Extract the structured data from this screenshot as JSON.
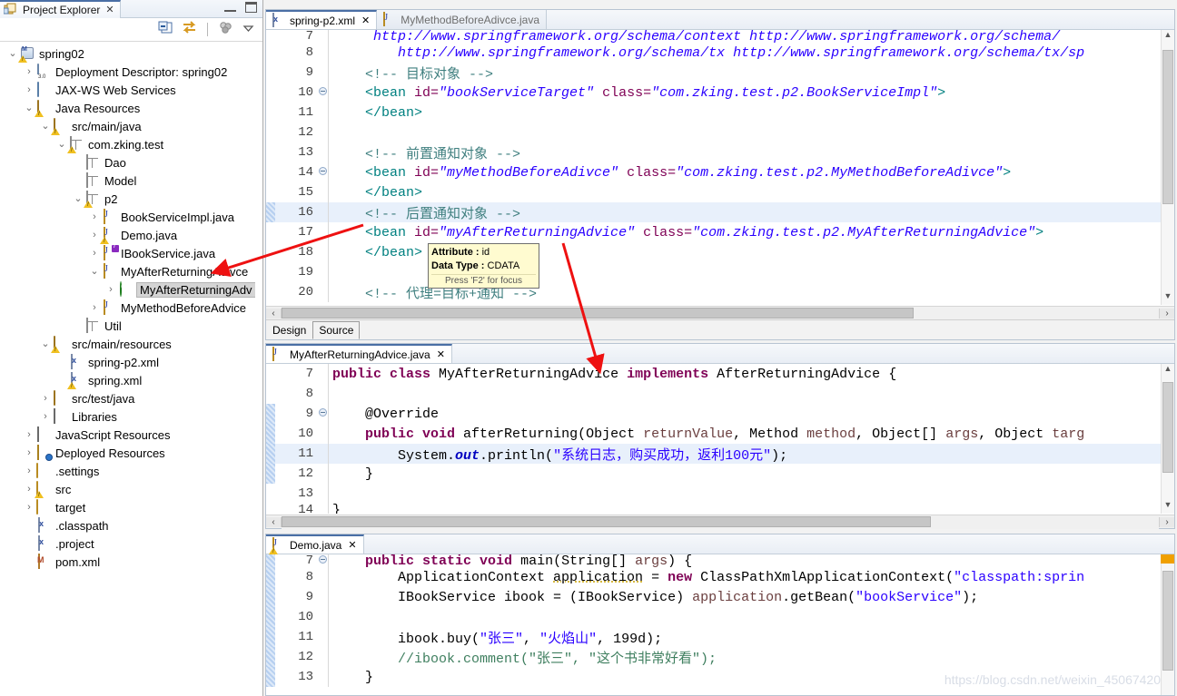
{
  "explorer": {
    "tab_title": "Project Explorer",
    "close_icon": "✕",
    "toolbar": {
      "collapse_all": "collapse-all-icon",
      "link_with_editor": "link-editor-icon",
      "view_menu": "view-menu-icon",
      "focus": "focus-icon"
    },
    "tree": [
      {
        "label": "spring02",
        "indent": 0,
        "twisty": "v",
        "icon": "maven-project",
        "warn": true
      },
      {
        "label": "Deployment Descriptor: spring02",
        "indent": 1,
        "twisty": ">",
        "icon": "deployment-descriptor"
      },
      {
        "label": "JAX-WS Web Services",
        "indent": 1,
        "twisty": ">",
        "icon": "web-services"
      },
      {
        "label": "Java Resources",
        "indent": 1,
        "twisty": "v",
        "icon": "java-resources",
        "warn": true
      },
      {
        "label": "src/main/java",
        "indent": 2,
        "twisty": "v",
        "icon": "source-folder",
        "warn": true
      },
      {
        "label": "com.zking.test",
        "indent": 3,
        "twisty": "v",
        "icon": "package",
        "warn": true
      },
      {
        "label": "Dao",
        "indent": 4,
        "twisty": "",
        "icon": "package"
      },
      {
        "label": "Model",
        "indent": 4,
        "twisty": "",
        "icon": "package"
      },
      {
        "label": "p2",
        "indent": 4,
        "twisty": "v",
        "icon": "package",
        "warn": true
      },
      {
        "label": "BookServiceImpl.java",
        "indent": 5,
        "twisty": ">",
        "icon": "java-file"
      },
      {
        "label": "Demo.java",
        "indent": 5,
        "twisty": ">",
        "icon": "java-file",
        "warn": true
      },
      {
        "label": "IBookService.java",
        "indent": 5,
        "twisty": ">",
        "icon": "java-interface"
      },
      {
        "label": "MyAfterReturningAdivce",
        "indent": 5,
        "twisty": "v",
        "icon": "java-file"
      },
      {
        "label": "MyAfterReturningAdv",
        "indent": 6,
        "twisty": ">",
        "icon": "class-green",
        "selected": true
      },
      {
        "label": "MyMethodBeforeAdvice",
        "indent": 5,
        "twisty": ">",
        "icon": "java-file"
      },
      {
        "label": "Util",
        "indent": 4,
        "twisty": "",
        "icon": "package"
      },
      {
        "label": "src/main/resources",
        "indent": 2,
        "twisty": "v",
        "icon": "source-folder",
        "warn": true
      },
      {
        "label": "spring-p2.xml",
        "indent": 3,
        "twisty": "",
        "icon": "xml-file"
      },
      {
        "label": "spring.xml",
        "indent": 3,
        "twisty": "",
        "icon": "xml-file",
        "warn": true
      },
      {
        "label": "src/test/java",
        "indent": 2,
        "twisty": ">",
        "icon": "source-folder"
      },
      {
        "label": "Libraries",
        "indent": 2,
        "twisty": ">",
        "icon": "libraries"
      },
      {
        "label": "JavaScript Resources",
        "indent": 1,
        "twisty": ">",
        "icon": "libraries"
      },
      {
        "label": "Deployed Resources",
        "indent": 1,
        "twisty": ">",
        "icon": "deployed-resources"
      },
      {
        "label": ".settings",
        "indent": 1,
        "twisty": ">",
        "icon": "folder"
      },
      {
        "label": "src",
        "indent": 1,
        "twisty": ">",
        "icon": "folder",
        "warn": true
      },
      {
        "label": "target",
        "indent": 1,
        "twisty": ">",
        "icon": "folder"
      },
      {
        "label": ".classpath",
        "indent": 1,
        "twisty": "",
        "icon": "xml-file"
      },
      {
        "label": ".project",
        "indent": 1,
        "twisty": "",
        "icon": "xml-file"
      },
      {
        "label": "pom.xml",
        "indent": 1,
        "twisty": "",
        "icon": "pom-file"
      }
    ]
  },
  "xml_editor": {
    "tabs": [
      {
        "label": "spring-p2.xml",
        "icon": "xml-file-icon",
        "active": true,
        "close": "✕"
      },
      {
        "label": "MyMethodBeforeAdivce.java",
        "icon": "java-file-icon",
        "active": false,
        "close": ""
      }
    ],
    "lines": [
      {
        "no": "7",
        "fold": false,
        "hl": false,
        "partial": true,
        "html": "<span class='x-url'>     http://www.springframework.org/schema/context http://www.springframework.org/schema/</span>"
      },
      {
        "no": "8",
        "fold": false,
        "hl": false,
        "html": "<span class='x-url'>        http://www.springframework.org/schema/tx http://www.springframework.org/schema/tx/sp</span>"
      },
      {
        "no": "9",
        "fold": false,
        "hl": false,
        "html": "<span class='x-cmt'>    &lt;!-- 目标对象 --&gt;</span>"
      },
      {
        "no": "10",
        "fold": true,
        "hl": false,
        "html": "<span class='x-tag'>    &lt;bean </span><span class='x-attr'>id=</span><span class='x-val'>\"bookServiceTarget\"</span><span class='x-attr'> class=</span><span class='x-val'>\"com.zking.test.p2.BookServiceImpl\"</span><span class='x-tag'>&gt;</span>"
      },
      {
        "no": "11",
        "fold": false,
        "hl": false,
        "html": "<span class='x-tag'>    &lt;/bean&gt;</span>"
      },
      {
        "no": "12",
        "fold": false,
        "hl": false,
        "html": ""
      },
      {
        "no": "13",
        "fold": false,
        "hl": false,
        "html": "<span class='x-cmt'>    &lt;!-- 前置通知对象 --&gt;</span>"
      },
      {
        "no": "14",
        "fold": true,
        "hl": false,
        "html": "<span class='x-tag'>    &lt;bean </span><span class='x-attr'>id=</span><span class='x-val'>\"myMethodBeforeAdivce\"</span><span class='x-attr'> class=</span><span class='x-val'>\"com.zking.test.p2.MyMethodBeforeAdivce\"</span><span class='x-tag'>&gt;</span>"
      },
      {
        "no": "15",
        "fold": false,
        "hl": false,
        "html": "<span class='x-tag'>    &lt;/bean&gt;</span>"
      },
      {
        "no": "16",
        "fold": false,
        "hl": true,
        "changed": true,
        "html": "<span class='x-cmt'>    &lt;!-- 后置通知对象 --&gt;</span>"
      },
      {
        "no": "17",
        "fold": false,
        "hl": false,
        "html": "<span class='x-tag'>    &lt;bean </span><span class='x-attr'>id=</span><span class='x-val'>\"myAfterReturningAdvice\"</span><span class='x-attr'> class=</span><span class='x-val'>\"com.zking.test.p2.MyAfterReturningAdvice\"</span><span class='x-tag'>&gt;</span>"
      },
      {
        "no": "18",
        "fold": false,
        "hl": false,
        "html": "<span class='x-tag'>    &lt;/bean&gt;</span>"
      },
      {
        "no": "19",
        "fold": false,
        "hl": false,
        "html": ""
      },
      {
        "no": "20",
        "fold": false,
        "hl": false,
        "html": "<span class='x-cmt'>    &lt;!-- 代理=目标+通知 --&gt;</span>"
      }
    ],
    "page_tabs": [
      {
        "label": "Design",
        "active": false
      },
      {
        "label": "Source",
        "active": true
      }
    ]
  },
  "tooltip": {
    "attribute_label": "Attribute :",
    "attribute_value": "id",
    "datatype_label": "Data Type :",
    "datatype_value": "CDATA",
    "hint": "Press 'F2' for focus"
  },
  "java_editor": {
    "tabs": [
      {
        "label": "MyAfterReturningAdvice.java",
        "icon": "java-file-icon",
        "active": true,
        "close": "✕"
      }
    ],
    "lines": [
      {
        "no": "7",
        "fold": false,
        "hl": false,
        "html": "<span class='j-kw'>public class</span> <span class='j-plain'>MyAfterReturningAdvice</span> <span class='j-kw'>implements</span> <span class='j-plain'>AfterReturningAdvice</span> <span class='j-plain'>{</span>"
      },
      {
        "no": "8",
        "fold": false,
        "hl": false,
        "html": ""
      },
      {
        "no": "9",
        "fold": true,
        "hl": false,
        "changed": true,
        "html": "<span class='j-plain'>    @Override</span>"
      },
      {
        "no": "10",
        "fold": false,
        "hl": false,
        "changed": true,
        "arrow": true,
        "html": "<span class='j-kw'>    public void</span> <span class='j-plain'>afterReturning(Object </span><span class='j-par'>returnValue</span><span class='j-plain'>, Method </span><span class='j-par'>method</span><span class='j-plain'>, Object[] </span><span class='j-par'>args</span><span class='j-plain'>, Object </span><span class='j-par'>targ</span>"
      },
      {
        "no": "11",
        "fold": false,
        "hl": true,
        "changed": true,
        "html": "<span class='j-plain'>        System.</span><span class='j-fld'>out</span><span class='j-plain'>.println(</span><span class='j-str'>\"系统日志，购买成功，返利100元\"</span><span class='j-plain'>);</span>"
      },
      {
        "no": "12",
        "fold": false,
        "hl": false,
        "changed": true,
        "html": "<span class='j-plain'>    }</span>"
      },
      {
        "no": "13",
        "fold": false,
        "hl": false,
        "html": ""
      },
      {
        "no": "14",
        "fold": false,
        "hl": false,
        "partial": true,
        "html": "<span class='j-plain'>}</span>"
      }
    ]
  },
  "demo_editor": {
    "tabs": [
      {
        "label": "Demo.java",
        "icon": "java-file-icon",
        "active": true,
        "close": "✕",
        "warn": true
      }
    ],
    "lines": [
      {
        "no": "7",
        "fold": true,
        "hl": false,
        "partial": true,
        "changed": true,
        "html": "<span class='j-kw'>    public static void</span> <span class='j-plain'>main(String[] </span><span class='j-par'>args</span><span class='j-plain'>) {</span>"
      },
      {
        "no": "8",
        "fold": false,
        "hl": false,
        "changed": true,
        "warn": true,
        "html": "<span class='j-plain'>        ApplicationContext </span><span class='j-underl j-plain'>application</span><span class='j-plain'> = </span><span class='j-kw'>new</span><span class='j-plain'> ClassPathXmlApplicationContext(</span><span class='j-str'>\"classpath:sprin</span>"
      },
      {
        "no": "9",
        "fold": false,
        "hl": false,
        "changed": true,
        "html": "<span class='j-plain'>        IBookService </span><span class='j-plain'>ibook</span><span class='j-plain'> = (IBookService) </span><span class='j-par'>application</span><span class='j-plain'>.getBean(</span><span class='j-str'>\"bookService\"</span><span class='j-plain'>);</span>"
      },
      {
        "no": "10",
        "fold": false,
        "hl": false,
        "changed": true,
        "html": ""
      },
      {
        "no": "11",
        "fold": false,
        "hl": false,
        "changed": true,
        "html": "<span class='j-plain'>        ibook.buy(</span><span class='j-str'>\"张三\"</span><span class='j-plain'>, </span><span class='j-str'>\"火焰山\"</span><span class='j-plain'>, 199d);</span>"
      },
      {
        "no": "12",
        "fold": false,
        "hl": false,
        "changed": true,
        "html": "<span class='j-cmt'>        //ibook.comment(\"张三\", \"这个书非常好看\");</span>"
      },
      {
        "no": "13",
        "fold": false,
        "hl": false,
        "changed": true,
        "html": "<span class='j-plain'>    }</span>"
      }
    ]
  },
  "watermark": "https://blog.csdn.net/weixin_45067420",
  "annotations": {
    "arrow1_name": "red-arrow-to-tree-node",
    "arrow2_name": "red-arrow-to-class-name",
    "color": "#ee1111"
  }
}
